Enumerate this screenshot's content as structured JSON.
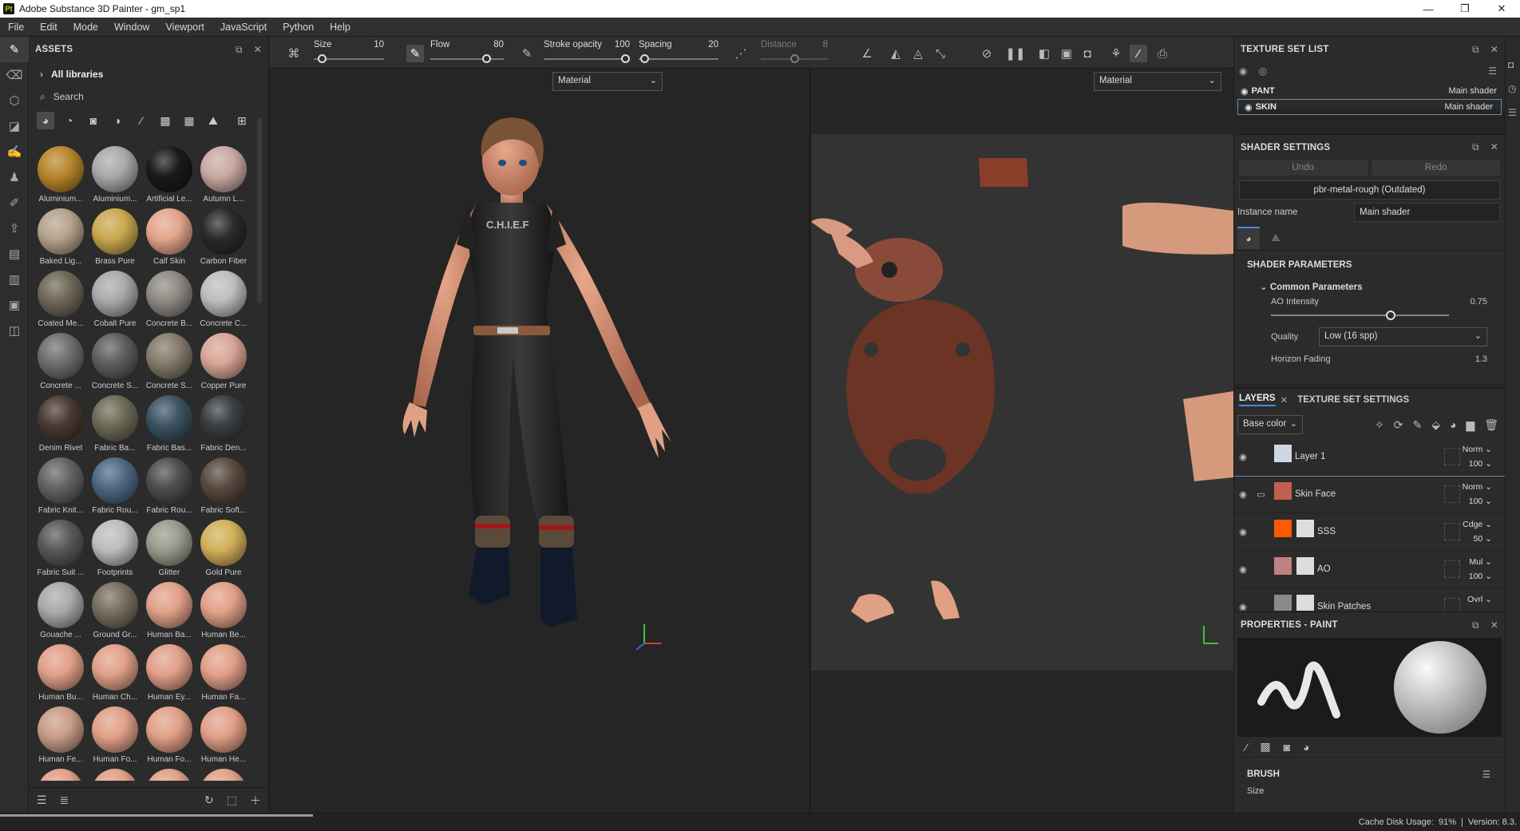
{
  "title_bar": {
    "app_icon": "Pt",
    "title": "Adobe Substance 3D Painter - gm_sp1",
    "minimize": "—",
    "maximize": "❐",
    "close": "✕"
  },
  "menu": [
    "File",
    "Edit",
    "Mode",
    "Window",
    "Viewport",
    "JavaScript",
    "Python",
    "Help"
  ],
  "assets": {
    "title": "ASSETS",
    "all_libraries": "All libraries",
    "search_placeholder": "Search",
    "materials": [
      {
        "name": "Aluminium...",
        "color": "#b8862b"
      },
      {
        "name": "Aluminium...",
        "color": "#a9a9ab"
      },
      {
        "name": "Artificial Le...",
        "color": "#1a1a1a"
      },
      {
        "name": "Autumn L...",
        "color": "#c9a9a2"
      },
      {
        "name": "Baked Lig...",
        "color": "#b5a38b"
      },
      {
        "name": "Brass Pure",
        "color": "#c9a84e"
      },
      {
        "name": "Calf Skin",
        "color": "#e3a58c"
      },
      {
        "name": "Carbon Fiber",
        "color": "#2a2a2a"
      },
      {
        "name": "Coated Me...",
        "color": "#6e6757"
      },
      {
        "name": "Cobalt Pure",
        "color": "#a9a9a9"
      },
      {
        "name": "Concrete B...",
        "color": "#8e8a83"
      },
      {
        "name": "Concrete C...",
        "color": "#bdbdbd"
      },
      {
        "name": "Concrete ...",
        "color": "#6e6e6e"
      },
      {
        "name": "Concrete S...",
        "color": "#5e5e5e"
      },
      {
        "name": "Concrete S...",
        "color": "#847a6c"
      },
      {
        "name": "Copper Pure",
        "color": "#d7a696"
      },
      {
        "name": "Denim Rivet",
        "color": "#4a3a32"
      },
      {
        "name": "Fabric Ba...",
        "color": "#6e6a57"
      },
      {
        "name": "Fabric Bas...",
        "color": "#3d5463"
      },
      {
        "name": "Fabric Den...",
        "color": "#3b3e42"
      },
      {
        "name": "Fabric Knit...",
        "color": "#636363"
      },
      {
        "name": "Fabric Rou...",
        "color": "#4d6884"
      },
      {
        "name": "Fabric Rou...",
        "color": "#4e4e4e"
      },
      {
        "name": "Fabric Soft...",
        "color": "#584a40"
      },
      {
        "name": "Fabric Suit ...",
        "color": "#595959"
      },
      {
        "name": "Footprints",
        "color": "#bcbcbc"
      },
      {
        "name": "Glitter",
        "color": "#9a9a8c"
      },
      {
        "name": "Gold Pure",
        "color": "#d2b05a"
      },
      {
        "name": "Gouache ...",
        "color": "#a9a9ab"
      },
      {
        "name": "Ground Gr...",
        "color": "#77705f"
      },
      {
        "name": "Human Ba...",
        "color": "#e1a088"
      },
      {
        "name": "Human Be...",
        "color": "#e1a088"
      },
      {
        "name": "Human Bu...",
        "color": "#e1a088"
      },
      {
        "name": "Human Ch...",
        "color": "#e1a088"
      },
      {
        "name": "Human Ey...",
        "color": "#e1a088"
      },
      {
        "name": "Human Fa...",
        "color": "#e1a088"
      },
      {
        "name": "Human Fe...",
        "color": "#c99c87"
      },
      {
        "name": "Human Fo...",
        "color": "#e1a088"
      },
      {
        "name": "Human Fo...",
        "color": "#e1a088"
      },
      {
        "name": "Human He...",
        "color": "#e1a088"
      },
      {
        "name": "",
        "color": "#e1a088"
      },
      {
        "name": "",
        "color": "#e1a088"
      },
      {
        "name": "",
        "color": "#e1a088"
      },
      {
        "name": "",
        "color": "#e1a088"
      }
    ]
  },
  "toolbar": {
    "size": {
      "label": "Size",
      "value": "10",
      "level": 0.07
    },
    "flow": {
      "label": "Flow",
      "value": "80",
      "level": 0.8
    },
    "stroke_opacity": {
      "label": "Stroke opacity",
      "value": "100",
      "level": 1.0
    },
    "spacing": {
      "label": "Spacing",
      "value": "20",
      "level": 0.02
    },
    "distance": {
      "label": "Distance",
      "value": "8",
      "level": 0.5
    }
  },
  "viewport_3d": {
    "mode": "Material"
  },
  "viewport_2d": {
    "mode": "Material"
  },
  "texture_set_list": {
    "title": "TEXTURE SET LIST",
    "sets": [
      {
        "name": "PANT",
        "shader": "Main shader"
      },
      {
        "name": "SKIN",
        "shader": "Main shader"
      }
    ]
  },
  "shader_settings": {
    "title": "SHADER SETTINGS",
    "undo": "Undo",
    "redo": "Redo",
    "shader": "pbr-metal-rough (Outdated)",
    "instance_label": "Instance name",
    "instance_value": "Main shader",
    "params_title": "SHADER PARAMETERS",
    "common_params": "Common Parameters",
    "ao_label": "AO Intensity",
    "ao_value": "0.75",
    "ao_level": 0.75,
    "quality_label": "Quality",
    "quality_value": "Low (16 spp)",
    "horizon_label": "Horizon Fading",
    "horizon_value": "1.3"
  },
  "layers_panel": {
    "tab_layers": "LAYERS",
    "tab_texture": "TEXTURE SET SETTINGS",
    "channel": "Base color",
    "layers": [
      {
        "name": "Layer 1",
        "blend": "Norm",
        "opacity": "100",
        "thumb": "#cfd7e3"
      },
      {
        "name": "Skin Face",
        "blend": "Norm",
        "opacity": "100",
        "thumb": "#c06050"
      },
      {
        "name": "SSS",
        "blend": "Cdge",
        "opacity": "50",
        "thumb": "#ff5a00"
      },
      {
        "name": "AO",
        "blend": "Mul",
        "opacity": "100",
        "thumb": "#c08080"
      },
      {
        "name": "Skin Patches",
        "blend": "Ovrl",
        "opacity": "",
        "thumb": "#8a8a8a"
      }
    ]
  },
  "properties": {
    "title": "PROPERTIES - PAINT",
    "brush": "BRUSH",
    "size_label": "Size"
  },
  "status": {
    "cache": "Cache Disk Usage:",
    "cache_value": "91%",
    "version": "Version: 8.3."
  }
}
